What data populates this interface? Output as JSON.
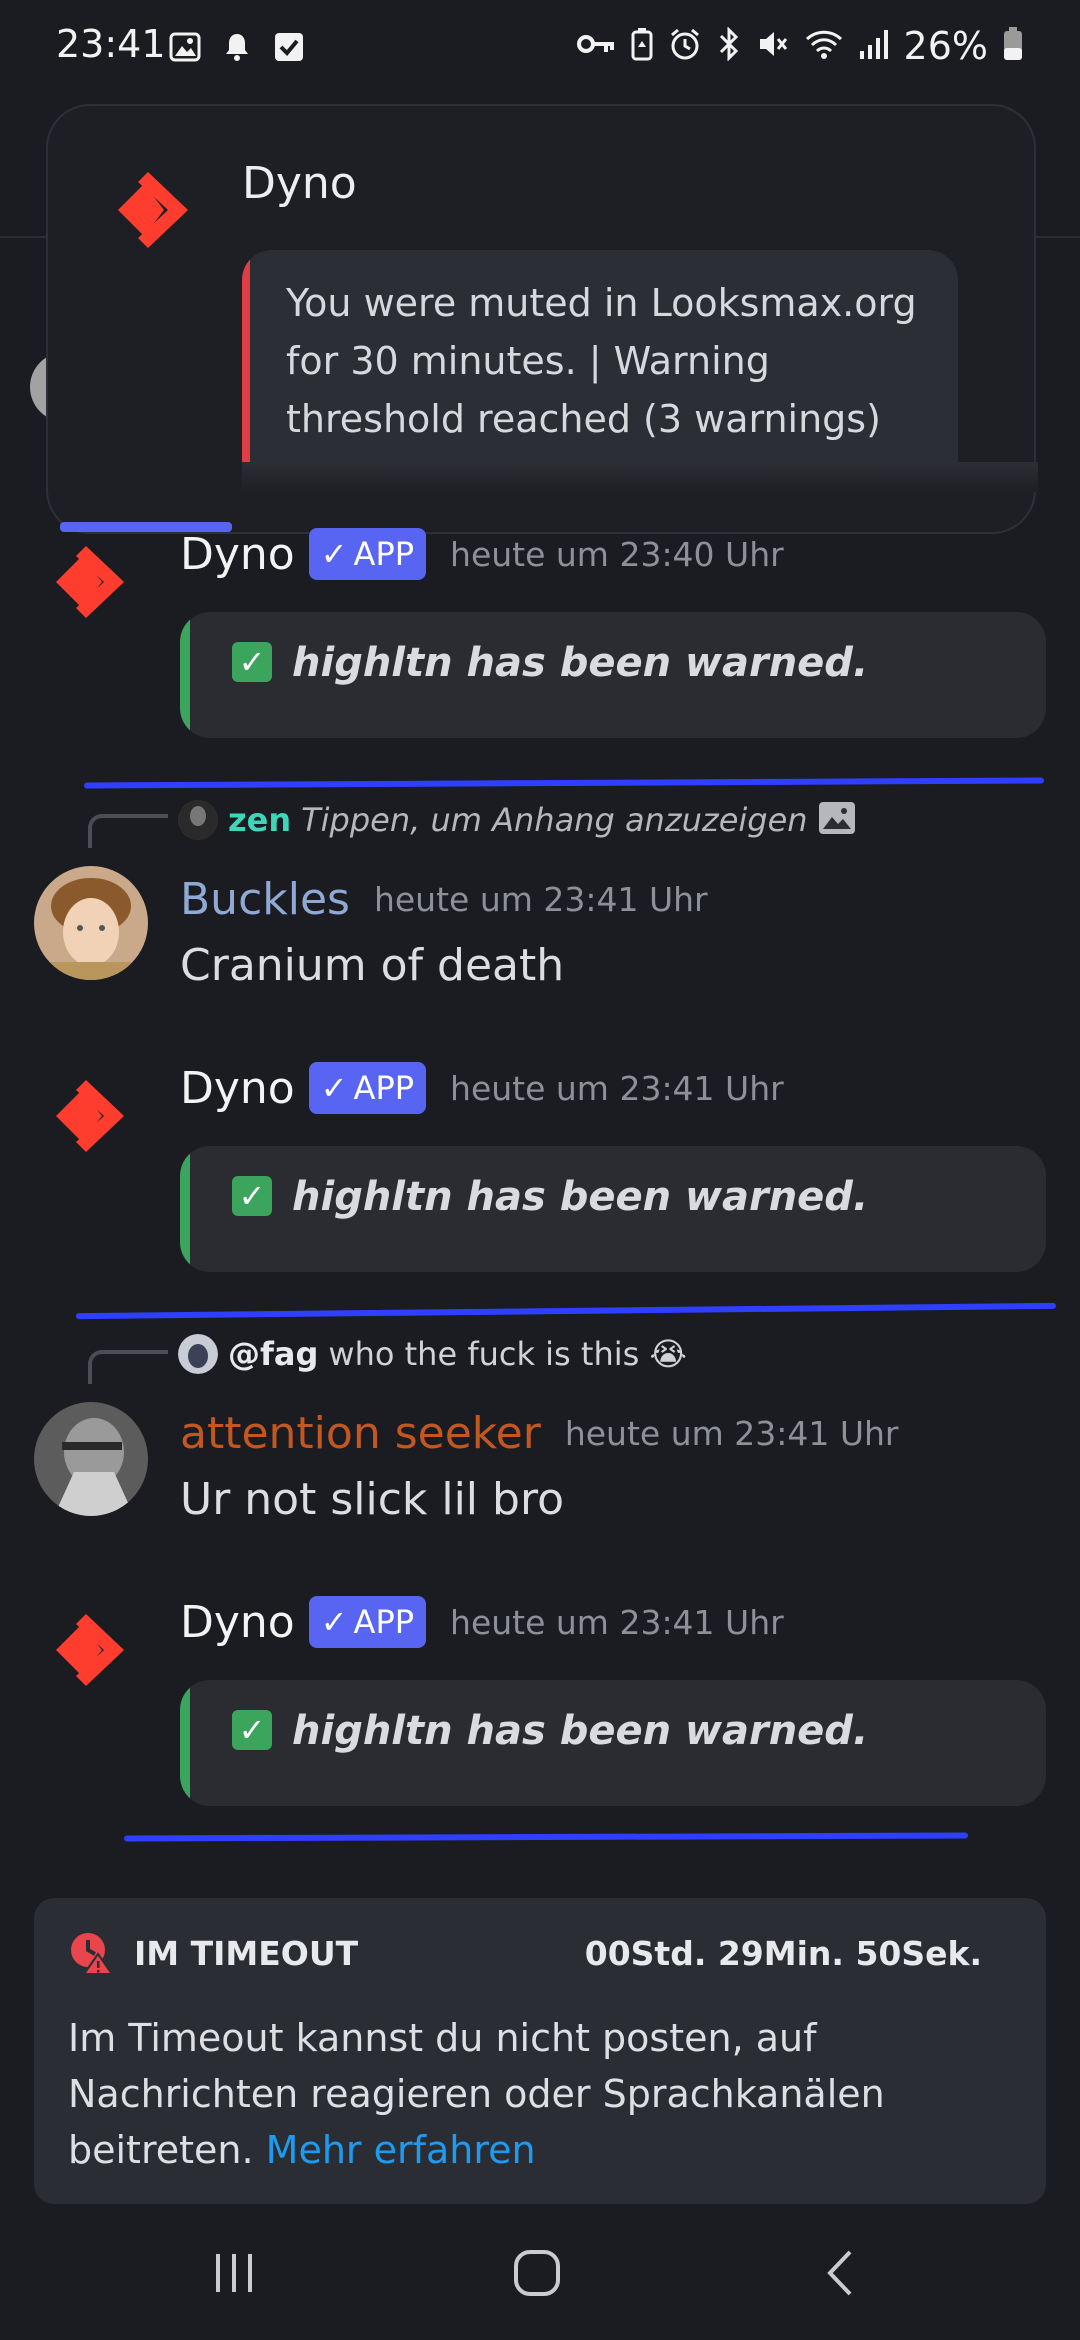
{
  "status_bar": {
    "time": "23:41",
    "battery": "26%",
    "left_icons": [
      "image-icon",
      "bell-icon",
      "checkbox-icon"
    ],
    "right_icons": [
      "key-icon",
      "battery-saver-icon",
      "alarm-icon",
      "bluetooth-icon",
      "mute-icon",
      "wifi-icon",
      "signal-icon",
      "battery-icon"
    ]
  },
  "notification": {
    "title": "Dyno",
    "text": "You were muted in Looksmax.org for 30 minutes. | Warning threshold reached (3 warnings)"
  },
  "messages": [
    {
      "author": "Dyno",
      "badge": "APP",
      "time": "heute um 23:40 Uhr",
      "embed": "highltn has been warned."
    },
    {
      "reply_author": "zen",
      "reply_text": "Tippen, um Anhang anzuzeigen",
      "author": "Buckles",
      "time": "heute um 23:41 Uhr",
      "body": "Cranium of death"
    },
    {
      "author": "Dyno",
      "badge": "APP",
      "time": "heute um 23:41 Uhr",
      "embed": "highltn has been warned."
    },
    {
      "reply_author": "@fag",
      "reply_text": "who the fuck is this 😭",
      "author": "attention seeker",
      "time": "heute um 23:41 Uhr",
      "body": "Ur not slick lil bro"
    },
    {
      "author": "Dyno",
      "badge": "APP",
      "time": "heute um 23:41 Uhr",
      "embed": "highltn has been warned."
    }
  ],
  "timeout": {
    "title": "IM TIMEOUT",
    "timer": "00Std. 29Min. 50Sek.",
    "body": "Im Timeout kannst du nicht posten, auf Nachrichten reagieren oder Sprachkanälen beitreten. ",
    "link": "Mehr erfahren"
  },
  "colors": {
    "accent": "#5865f2",
    "dyno_red": "#ff3d2e",
    "success": "#3ba55d",
    "buckles_name": "#8fa8d4",
    "attention_name": "#c2571f",
    "link": "#1c9bf0",
    "annotation_line": "#2f3fff"
  }
}
